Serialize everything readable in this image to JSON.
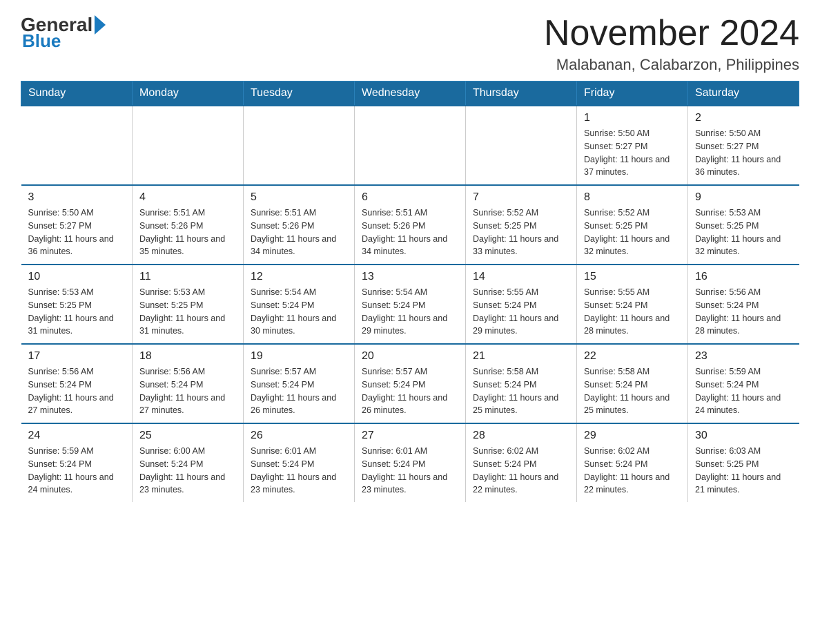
{
  "logo": {
    "general": "General",
    "blue": "Blue",
    "subtitle": "Blue"
  },
  "header": {
    "title": "November 2024",
    "location": "Malabanan, Calabarzon, Philippines"
  },
  "weekdays": [
    "Sunday",
    "Monday",
    "Tuesday",
    "Wednesday",
    "Thursday",
    "Friday",
    "Saturday"
  ],
  "weeks": [
    [
      {
        "day": "",
        "info": ""
      },
      {
        "day": "",
        "info": ""
      },
      {
        "day": "",
        "info": ""
      },
      {
        "day": "",
        "info": ""
      },
      {
        "day": "",
        "info": ""
      },
      {
        "day": "1",
        "info": "Sunrise: 5:50 AM\nSunset: 5:27 PM\nDaylight: 11 hours and 37 minutes."
      },
      {
        "day": "2",
        "info": "Sunrise: 5:50 AM\nSunset: 5:27 PM\nDaylight: 11 hours and 36 minutes."
      }
    ],
    [
      {
        "day": "3",
        "info": "Sunrise: 5:50 AM\nSunset: 5:27 PM\nDaylight: 11 hours and 36 minutes."
      },
      {
        "day": "4",
        "info": "Sunrise: 5:51 AM\nSunset: 5:26 PM\nDaylight: 11 hours and 35 minutes."
      },
      {
        "day": "5",
        "info": "Sunrise: 5:51 AM\nSunset: 5:26 PM\nDaylight: 11 hours and 34 minutes."
      },
      {
        "day": "6",
        "info": "Sunrise: 5:51 AM\nSunset: 5:26 PM\nDaylight: 11 hours and 34 minutes."
      },
      {
        "day": "7",
        "info": "Sunrise: 5:52 AM\nSunset: 5:25 PM\nDaylight: 11 hours and 33 minutes."
      },
      {
        "day": "8",
        "info": "Sunrise: 5:52 AM\nSunset: 5:25 PM\nDaylight: 11 hours and 32 minutes."
      },
      {
        "day": "9",
        "info": "Sunrise: 5:53 AM\nSunset: 5:25 PM\nDaylight: 11 hours and 32 minutes."
      }
    ],
    [
      {
        "day": "10",
        "info": "Sunrise: 5:53 AM\nSunset: 5:25 PM\nDaylight: 11 hours and 31 minutes."
      },
      {
        "day": "11",
        "info": "Sunrise: 5:53 AM\nSunset: 5:25 PM\nDaylight: 11 hours and 31 minutes."
      },
      {
        "day": "12",
        "info": "Sunrise: 5:54 AM\nSunset: 5:24 PM\nDaylight: 11 hours and 30 minutes."
      },
      {
        "day": "13",
        "info": "Sunrise: 5:54 AM\nSunset: 5:24 PM\nDaylight: 11 hours and 29 minutes."
      },
      {
        "day": "14",
        "info": "Sunrise: 5:55 AM\nSunset: 5:24 PM\nDaylight: 11 hours and 29 minutes."
      },
      {
        "day": "15",
        "info": "Sunrise: 5:55 AM\nSunset: 5:24 PM\nDaylight: 11 hours and 28 minutes."
      },
      {
        "day": "16",
        "info": "Sunrise: 5:56 AM\nSunset: 5:24 PM\nDaylight: 11 hours and 28 minutes."
      }
    ],
    [
      {
        "day": "17",
        "info": "Sunrise: 5:56 AM\nSunset: 5:24 PM\nDaylight: 11 hours and 27 minutes."
      },
      {
        "day": "18",
        "info": "Sunrise: 5:56 AM\nSunset: 5:24 PM\nDaylight: 11 hours and 27 minutes."
      },
      {
        "day": "19",
        "info": "Sunrise: 5:57 AM\nSunset: 5:24 PM\nDaylight: 11 hours and 26 minutes."
      },
      {
        "day": "20",
        "info": "Sunrise: 5:57 AM\nSunset: 5:24 PM\nDaylight: 11 hours and 26 minutes."
      },
      {
        "day": "21",
        "info": "Sunrise: 5:58 AM\nSunset: 5:24 PM\nDaylight: 11 hours and 25 minutes."
      },
      {
        "day": "22",
        "info": "Sunrise: 5:58 AM\nSunset: 5:24 PM\nDaylight: 11 hours and 25 minutes."
      },
      {
        "day": "23",
        "info": "Sunrise: 5:59 AM\nSunset: 5:24 PM\nDaylight: 11 hours and 24 minutes."
      }
    ],
    [
      {
        "day": "24",
        "info": "Sunrise: 5:59 AM\nSunset: 5:24 PM\nDaylight: 11 hours and 24 minutes."
      },
      {
        "day": "25",
        "info": "Sunrise: 6:00 AM\nSunset: 5:24 PM\nDaylight: 11 hours and 23 minutes."
      },
      {
        "day": "26",
        "info": "Sunrise: 6:01 AM\nSunset: 5:24 PM\nDaylight: 11 hours and 23 minutes."
      },
      {
        "day": "27",
        "info": "Sunrise: 6:01 AM\nSunset: 5:24 PM\nDaylight: 11 hours and 23 minutes."
      },
      {
        "day": "28",
        "info": "Sunrise: 6:02 AM\nSunset: 5:24 PM\nDaylight: 11 hours and 22 minutes."
      },
      {
        "day": "29",
        "info": "Sunrise: 6:02 AM\nSunset: 5:24 PM\nDaylight: 11 hours and 22 minutes."
      },
      {
        "day": "30",
        "info": "Sunrise: 6:03 AM\nSunset: 5:25 PM\nDaylight: 11 hours and 21 minutes."
      }
    ]
  ]
}
